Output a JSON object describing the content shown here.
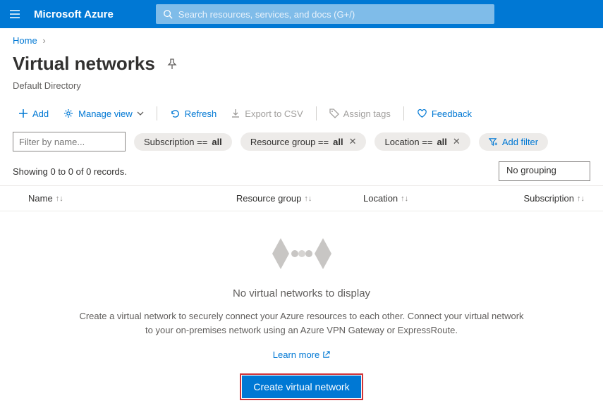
{
  "brand": "Microsoft Azure",
  "search": {
    "placeholder": "Search resources, services, and docs (G+/)"
  },
  "breadcrumb": {
    "home": "Home"
  },
  "page": {
    "title": "Virtual networks",
    "subtitle": "Default Directory"
  },
  "commands": {
    "add": "Add",
    "manage_view": "Manage view",
    "refresh": "Refresh",
    "export_csv": "Export to CSV",
    "assign_tags": "Assign tags",
    "feedback": "Feedback"
  },
  "filters": {
    "name_placeholder": "Filter by name...",
    "subscription": {
      "label": "Subscription ==",
      "value": "all"
    },
    "resource_group": {
      "label": "Resource group ==",
      "value": "all"
    },
    "location": {
      "label": "Location ==",
      "value": "all"
    },
    "add_filter": "Add filter"
  },
  "list": {
    "record_count": "Showing 0 to 0 of 0 records.",
    "grouping": "No grouping",
    "columns": {
      "name": "Name",
      "rg": "Resource group",
      "loc": "Location",
      "sub": "Subscription"
    }
  },
  "empty": {
    "title": "No virtual networks to display",
    "desc": "Create a virtual network to securely connect your Azure resources to each other. Connect your virtual network to your on-premises network using an Azure VPN Gateway or ExpressRoute.",
    "learn": "Learn more",
    "button": "Create virtual network"
  }
}
